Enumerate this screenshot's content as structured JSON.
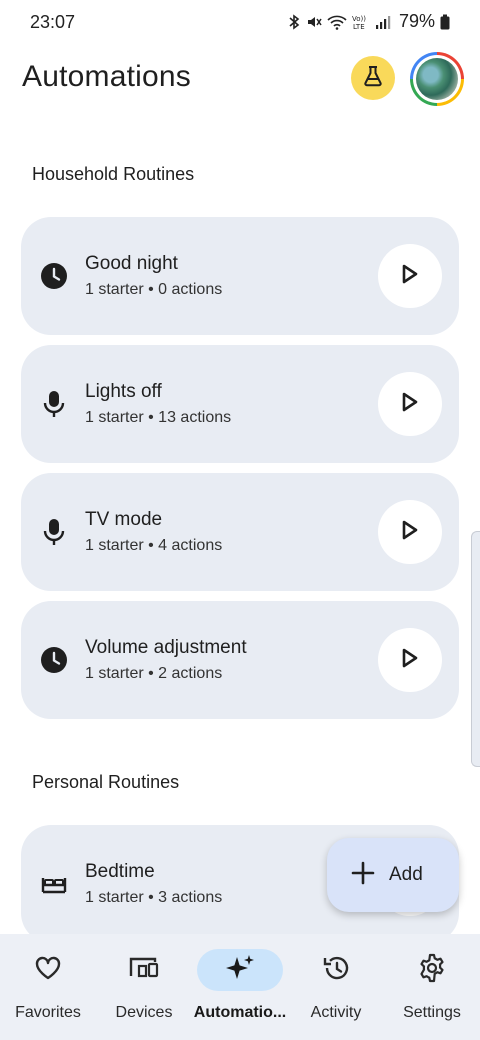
{
  "status_bar": {
    "time": "23:07",
    "battery": "79%",
    "icons": [
      "bluetooth-icon",
      "mute-icon",
      "wifi-icon",
      "volte-icon",
      "signal-icon",
      "battery-icon"
    ]
  },
  "header": {
    "title": "Automations",
    "labs_icon": "flask-icon",
    "avatar": "account-avatar"
  },
  "sections": {
    "household": {
      "title": "Household Routines",
      "routines": [
        {
          "name": "Good night",
          "summary": "1 starter • 0 actions",
          "icon": "clock-icon"
        },
        {
          "name": "Lights off",
          "summary": "1 starter • 13 actions",
          "icon": "microphone-icon"
        },
        {
          "name": "TV mode",
          "summary": "1 starter • 4 actions",
          "icon": "microphone-icon"
        },
        {
          "name": "Volume adjustment",
          "summary": "1 starter • 2 actions",
          "icon": "clock-icon"
        }
      ]
    },
    "personal": {
      "title": "Personal Routines",
      "routines": [
        {
          "name": "Bedtime",
          "summary": "1 starter • 3 actions",
          "icon": "bed-icon"
        }
      ]
    }
  },
  "fab": {
    "label": "Add",
    "icon": "plus-icon"
  },
  "bottom_nav": {
    "items": [
      {
        "label": "Favorites",
        "icon": "heart-icon"
      },
      {
        "label": "Devices",
        "icon": "devices-icon"
      },
      {
        "label": "Automatio...",
        "icon": "sparkle-icon",
        "active": true
      },
      {
        "label": "Activity",
        "icon": "history-icon"
      },
      {
        "label": "Settings",
        "icon": "gear-icon"
      }
    ]
  },
  "colors": {
    "card_bg": "#e8ecf3",
    "nav_bg": "#edf0f6",
    "active_pill": "#cbe4fb",
    "fab_bg": "#d9e3f9",
    "labs_bg": "#f9d95a"
  }
}
